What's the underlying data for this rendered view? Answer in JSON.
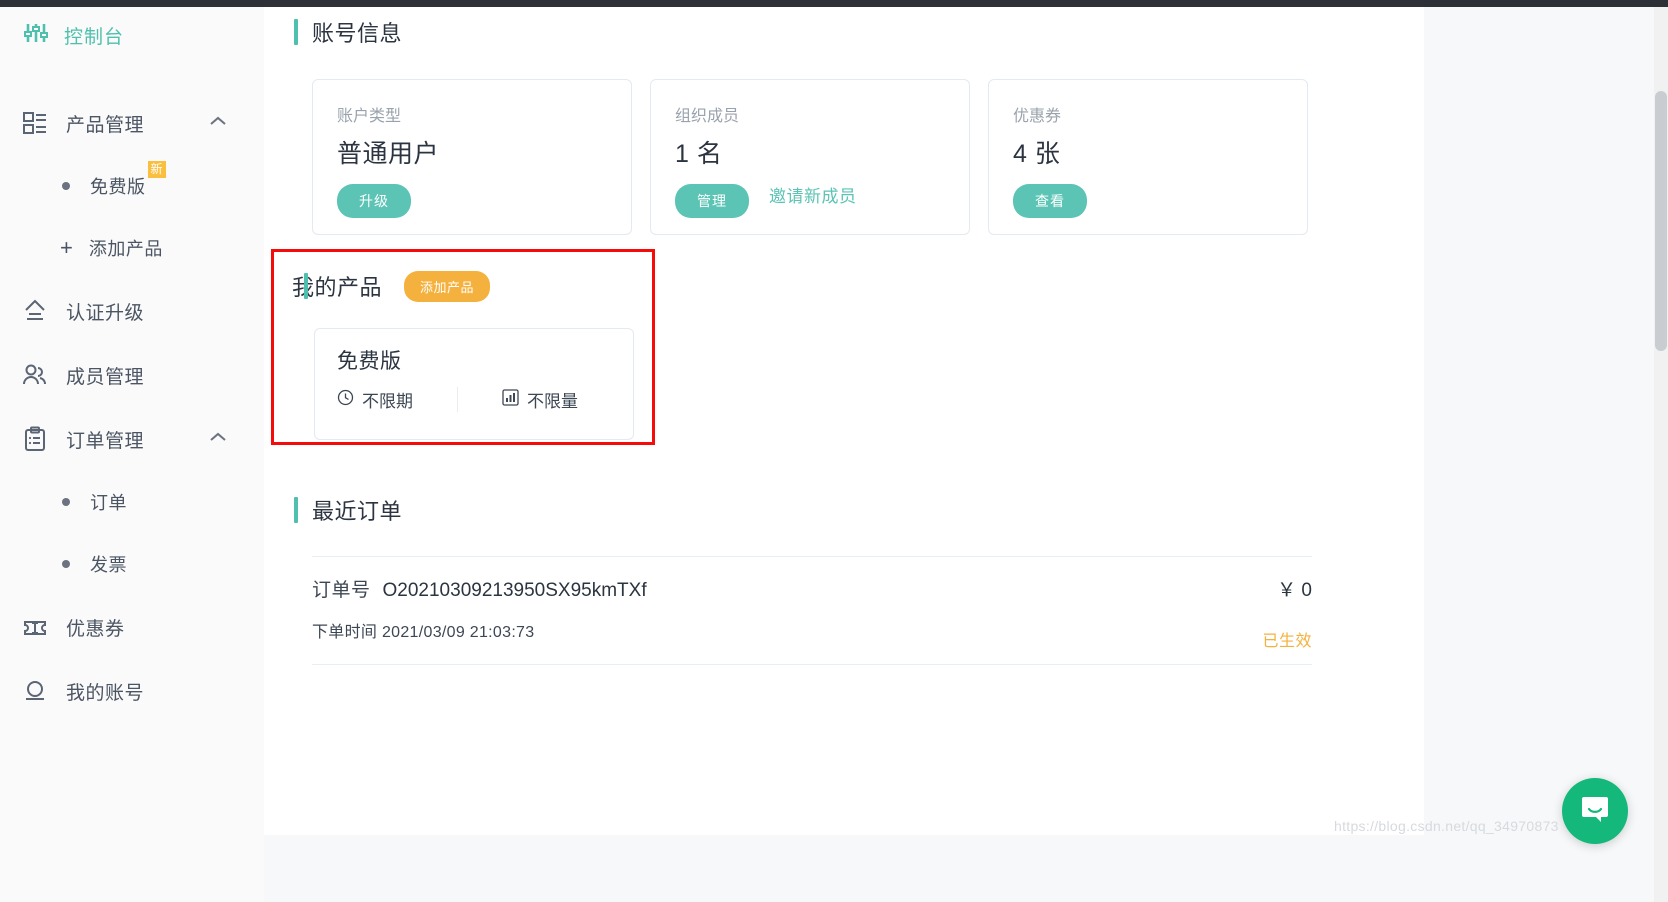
{
  "sidebar": {
    "brand": {
      "label": "控制台",
      "icon": "sliders-icon"
    },
    "items": [
      {
        "label": "产品管理",
        "icon": "grid-list-icon",
        "expanded": true,
        "chevron": "chevron-up-icon"
      },
      {
        "label": "认证升级",
        "icon": "upload-arrow-icon"
      },
      {
        "label": "成员管理",
        "icon": "users-icon"
      },
      {
        "label": "订单管理",
        "icon": "clipboard-icon",
        "expanded": true,
        "chevron": "chevron-up-icon"
      },
      {
        "label": "优惠券",
        "icon": "ticket-icon"
      },
      {
        "label": "我的账号",
        "icon": "user-circle-icon"
      }
    ],
    "product_sub": [
      {
        "label": "免费版",
        "badge": "新",
        "marker": "dot"
      },
      {
        "label": "添加产品",
        "marker": "plus"
      }
    ],
    "order_sub": [
      {
        "label": "订单",
        "marker": "dot"
      },
      {
        "label": "发票",
        "marker": "dot"
      }
    ]
  },
  "account_info": {
    "title": "账号信息",
    "cards": [
      {
        "label": "账户类型",
        "value": "普通用户",
        "button": "升级"
      },
      {
        "label": "组织成员",
        "value": "1 名",
        "button": "管理",
        "link": "邀请新成员"
      },
      {
        "label": "优惠券",
        "value": "4 张",
        "button": "查看"
      }
    ]
  },
  "my_product": {
    "title": "我的产品",
    "add_button": "添加产品",
    "card": {
      "name": "免费版",
      "duration": {
        "icon": "clock-icon",
        "text": "不限期"
      },
      "quota": {
        "icon": "bar-chart-icon",
        "text": "不限量"
      }
    }
  },
  "recent_orders": {
    "title": "最近订单",
    "orders": [
      {
        "number_label": "订单号",
        "number": "O20210309213950SX95kmTXf",
        "time_label": "下单时间",
        "time": "2021/03/09 21:03:73",
        "price": "￥ 0",
        "status": "已生效"
      }
    ]
  },
  "chat": {
    "icon": "chat-bubble-icon"
  },
  "watermark": "https://blog.csdn.net/qq_34970873",
  "colors": {
    "accent_teal": "#5bc4b5",
    "brand_teal": "#4fc0ad",
    "accent_orange": "#f5b13d",
    "highlight_red": "#f60b0b",
    "chat_green": "#14b87a",
    "text_dark": "#2b3440",
    "text_muted": "#9aa3ad"
  }
}
